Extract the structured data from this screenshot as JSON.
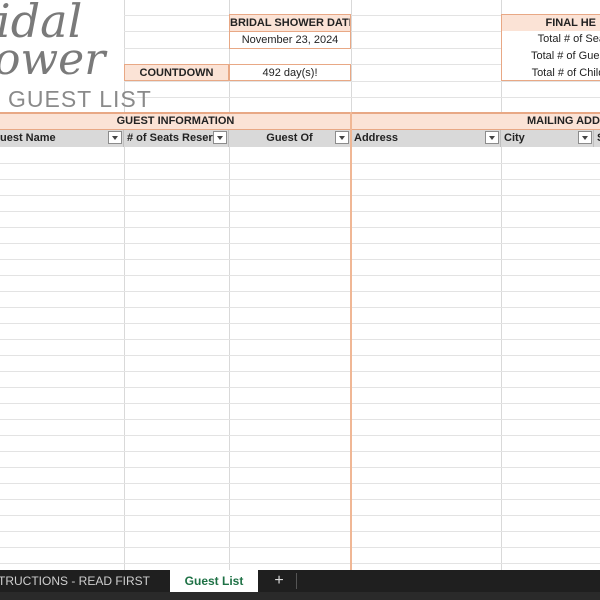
{
  "logo": {
    "line1": "idal",
    "line2": "ower",
    "line3": "GUEST LIST"
  },
  "event": {
    "date_label": "BRIDAL SHOWER DATE",
    "date_value": "November 23, 2024",
    "countdown_label": "COUNTDOWN",
    "countdown_value": "492 day(s)!"
  },
  "final_headcount": {
    "title": "FINAL HE",
    "rows": [
      "Total # of Seat",
      "Total # of Guest",
      "Total # of Childr"
    ]
  },
  "sections": {
    "guest_info": "GUEST INFORMATION",
    "mailing": "MAILING ADDR"
  },
  "columns": [
    "uest Name",
    "# of Seats Reserv",
    "Guest Of",
    "Address",
    "City",
    "S"
  ],
  "tabs": {
    "instructions": "TRUCTIONS - READ FIRST",
    "guest_list": "Guest List",
    "add": "+"
  },
  "colors": {
    "accent": "#e8a885",
    "header_fill": "#fbe3d6",
    "active_tab_text": "#1e7145"
  }
}
